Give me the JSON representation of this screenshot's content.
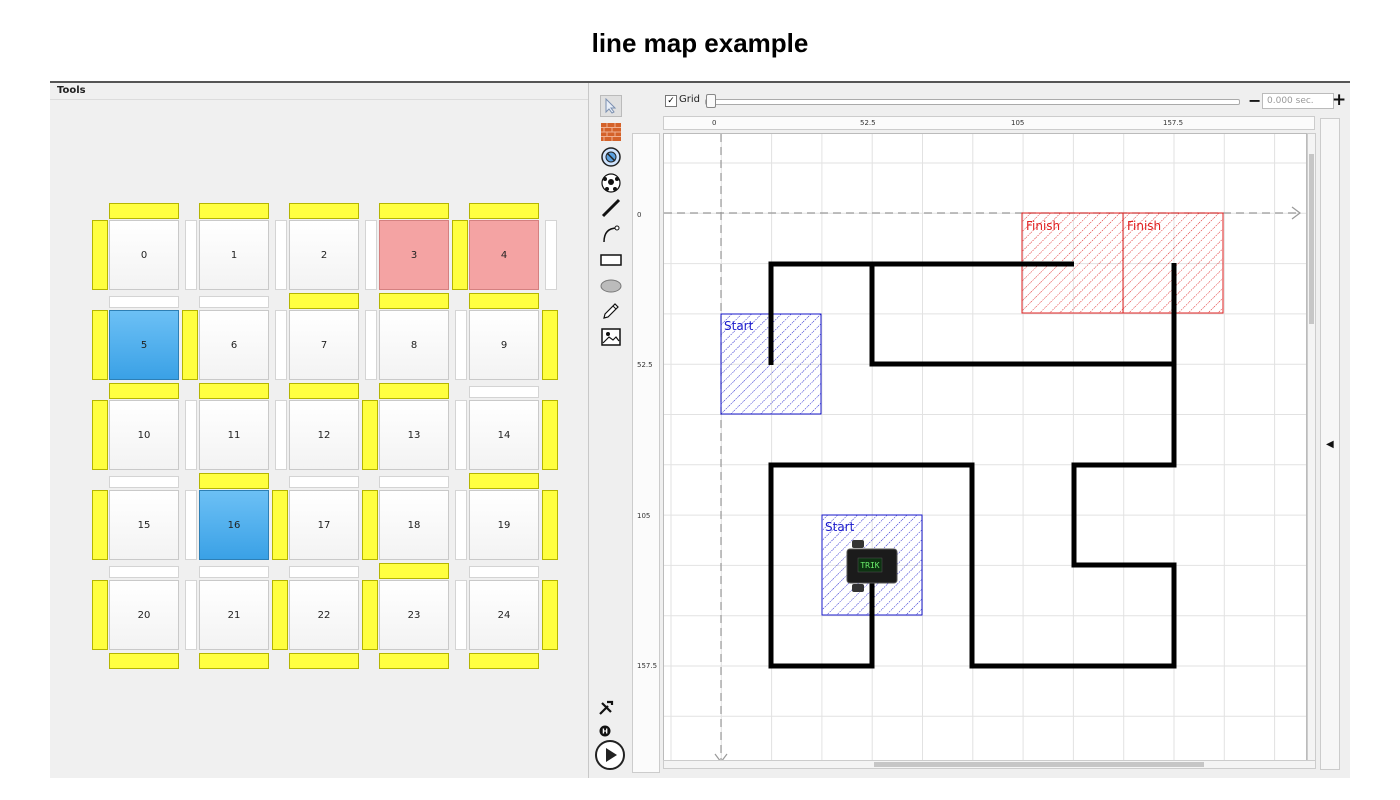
{
  "page": {
    "title": "line map example"
  },
  "tools_panel": {
    "title": "Tools"
  },
  "grid_field": {
    "cells": [
      {
        "label": "0",
        "state": "normal"
      },
      {
        "label": "1",
        "state": "normal"
      },
      {
        "label": "2",
        "state": "normal"
      },
      {
        "label": "3",
        "state": "red"
      },
      {
        "label": "4",
        "state": "red"
      },
      {
        "label": "5",
        "state": "blue"
      },
      {
        "label": "6",
        "state": "normal"
      },
      {
        "label": "7",
        "state": "normal"
      },
      {
        "label": "8",
        "state": "normal"
      },
      {
        "label": "9",
        "state": "normal"
      },
      {
        "label": "10",
        "state": "normal"
      },
      {
        "label": "11",
        "state": "normal"
      },
      {
        "label": "12",
        "state": "normal"
      },
      {
        "label": "13",
        "state": "normal"
      },
      {
        "label": "14",
        "state": "normal"
      },
      {
        "label": "15",
        "state": "normal"
      },
      {
        "label": "16",
        "state": "blue"
      },
      {
        "label": "17",
        "state": "normal"
      },
      {
        "label": "18",
        "state": "normal"
      },
      {
        "label": "19",
        "state": "normal"
      },
      {
        "label": "20",
        "state": "normal"
      },
      {
        "label": "21",
        "state": "normal"
      },
      {
        "label": "22",
        "state": "normal"
      },
      {
        "label": "23",
        "state": "normal"
      },
      {
        "label": "24",
        "state": "normal"
      }
    ],
    "h_walls": [
      [
        1,
        1,
        1,
        1,
        1
      ],
      [
        0,
        0,
        1,
        1,
        1
      ],
      [
        1,
        1,
        1,
        1,
        0
      ],
      [
        0,
        1,
        0,
        0,
        1
      ],
      [
        0,
        0,
        0,
        1,
        0
      ],
      [
        1,
        1,
        1,
        1,
        1
      ]
    ],
    "v_walls": [
      [
        1,
        0,
        0,
        0,
        1,
        0
      ],
      [
        1,
        1,
        0,
        0,
        0,
        1
      ],
      [
        1,
        0,
        0,
        1,
        0,
        1
      ],
      [
        1,
        0,
        1,
        1,
        0,
        1
      ],
      [
        1,
        0,
        1,
        1,
        0,
        1
      ]
    ],
    "colors": {
      "wall": "#ffff40",
      "red_cell": "#f4a3a3",
      "blue_cell": "#3aa1e6"
    }
  },
  "scene": {
    "grid_checkbox": {
      "checked": true,
      "check_mark": "✓",
      "label": "Grid"
    },
    "time_field": {
      "placeholder": "0.000 sec."
    },
    "minus_label": "−",
    "plus_label": "+",
    "hruler_ticks": [
      "0",
      "52.5",
      "105",
      "157.5"
    ],
    "vruler_ticks": [
      "0",
      "52.5",
      "105",
      "157.5"
    ],
    "zones": [
      {
        "label": "Start",
        "color": "blue"
      },
      {
        "label": "Start",
        "color": "blue"
      },
      {
        "label": "Finish",
        "color": "red"
      },
      {
        "label": "Finish",
        "color": "red"
      }
    ],
    "robot": {
      "label": "TRIK"
    },
    "colors": {
      "line": "#000000",
      "start_zone": "#1a1acc",
      "finish_zone": "#e02020",
      "grid": "#e2e2e2"
    }
  },
  "toolbar": {
    "icons": [
      "cursor-icon",
      "wall-icon",
      "skittle-icon",
      "ball-icon",
      "line-icon",
      "curve-icon",
      "rectangle-icon",
      "ellipse-icon",
      "pencil-icon",
      "image-icon"
    ],
    "bottom_icons": [
      "settings-icon",
      "reset-icon",
      "run-icon"
    ]
  }
}
